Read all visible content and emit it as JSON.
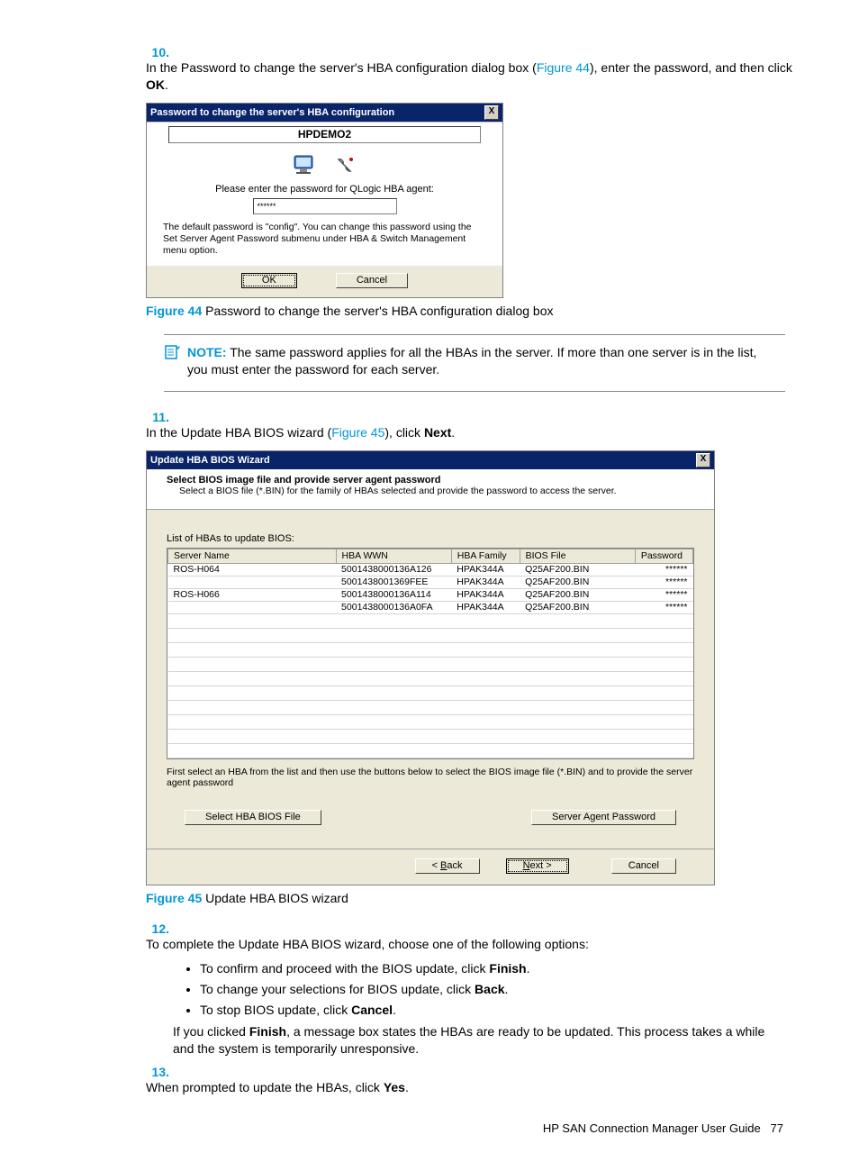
{
  "steps": {
    "s10": {
      "num": "10.",
      "t1": "In the Password to change the server's HBA configuration dialog box (",
      "t2": "Figure 44",
      "t3": "), enter the password, and then click ",
      "t4": "OK",
      "t5": "."
    },
    "s11": {
      "num": "11.",
      "t1": "In the Update HBA BIOS wizard (",
      "t2": "Figure 45",
      "t3": "), click ",
      "t4": "Next",
      "t5": "."
    },
    "s12": {
      "num": "12.",
      "t": "To complete the Update HBA BIOS wizard, choose one of the following options:"
    },
    "s13": {
      "num": "13.",
      "t1": "When prompted to update the HBAs, click ",
      "t2": "Yes",
      "t3": "."
    }
  },
  "fig44": {
    "num": "Figure 44",
    "caption": " Password to change the server's HBA configuration dialog box"
  },
  "fig45": {
    "num": "Figure 45",
    "caption": " Update HBA BIOS wizard"
  },
  "note": {
    "label": "NOTE:",
    "text": "   The same password applies for all the HBAs in the server. If more than one server is in the list, you must enter the password for each server."
  },
  "dialog1": {
    "title": "Password to change the server's HBA configuration",
    "close": "X",
    "server": "HPDEMO2",
    "prompt": "Please enter the password for QLogic HBA agent:",
    "value": "******",
    "default_text": "The default password is \"config\". You can change this password using the Set Server Agent Password submenu under HBA & Switch Management menu option.",
    "ok": "OK",
    "cancel": "Cancel"
  },
  "dialog2": {
    "title": "Update HBA BIOS Wizard",
    "close": "X",
    "head_title": "Select BIOS image file and provide server agent password",
    "head_sub": "Select a BIOS file (*.BIN) for the family of HBAs selected and provide the password to access the server.",
    "list_label": "List of HBAs to update BIOS:",
    "cols": {
      "server": "Server Name",
      "wwn": "HBA WWN",
      "family": "HBA Family",
      "bios": "BIOS File",
      "pw": "Password"
    },
    "rows": [
      {
        "server": "ROS-H064",
        "wwn": "5001438000136A126",
        "family": "HPAK344A",
        "bios": "Q25AF200.BIN",
        "pw": "******"
      },
      {
        "server": "",
        "wwn": "5001438001369FEE",
        "family": "HPAK344A",
        "bios": "Q25AF200.BIN",
        "pw": "******"
      },
      {
        "server": "ROS-H066",
        "wwn": "5001438000136A114",
        "family": "HPAK344A",
        "bios": "Q25AF200.BIN",
        "pw": "******"
      },
      {
        "server": "",
        "wwn": "5001438000136A0FA",
        "family": "HPAK344A",
        "bios": "Q25AF200.BIN",
        "pw": "******"
      }
    ],
    "hint": "First select an HBA from the list and then use the buttons below to select the BIOS image file (*.BIN) and to provide the server agent password",
    "btn_select_file": "Select HBA BIOS File",
    "btn_server_pw": "Server Agent Password",
    "btn_back_pre": "< ",
    "btn_back_u": "B",
    "btn_back_post": "ack",
    "btn_next_u": "N",
    "btn_next_post": "ext >",
    "btn_cancel": "Cancel"
  },
  "bullets": {
    "b1a": "To confirm and proceed with the BIOS update, click ",
    "b1b": "Finish",
    "b1c": ".",
    "b2a": "To change your selections for BIOS update, click ",
    "b2b": "Back",
    "b2c": ".",
    "b3a": "To stop BIOS update, click ",
    "b3b": "Cancel",
    "b3c": "."
  },
  "after": {
    "t1": "If you clicked ",
    "t2": "Finish",
    "t3": ", a message box states the HBAs are ready to be updated. This process takes a while and the system is temporarily unresponsive."
  },
  "footer": {
    "doc": "HP SAN Connection Manager User Guide",
    "page": "77"
  }
}
